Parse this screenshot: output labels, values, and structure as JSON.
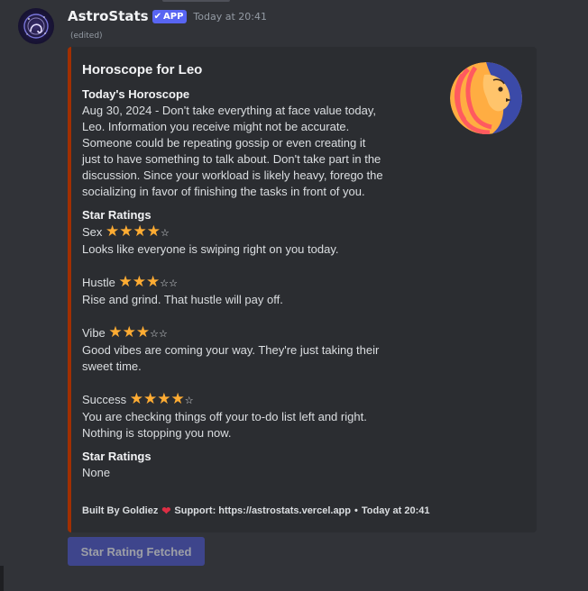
{
  "message": {
    "username": "AstroStats",
    "app_badge": "APP",
    "timestamp": "Today at 20:41",
    "edited": "(edited)"
  },
  "embed": {
    "title": "Horoscope for Leo",
    "accent_color": "#a12f00",
    "todays_horoscope": {
      "name": "Today's Horoscope",
      "value": "Aug 30, 2024 - Don't take everything at face value today, Leo. Information you receive might not be accurate. Someone could be repeating gossip or even creating it just to have something to talk about. Don't take part in the discussion. Since your workload is likely heavy, forego the socializing in favor of finishing the tasks in front of you."
    },
    "star_ratings": {
      "name": "Star Ratings",
      "items": [
        {
          "label": "Sex",
          "rating": 4,
          "max": 5,
          "description": "Looks like everyone is swiping right on you today."
        },
        {
          "label": "Hustle",
          "rating": 3,
          "max": 5,
          "description": "Rise and grind. That hustle will pay off."
        },
        {
          "label": "Vibe",
          "rating": 3,
          "max": 5,
          "description": "Good vibes are coming your way. They're just taking their sweet time."
        },
        {
          "label": "Success",
          "rating": 4,
          "max": 5,
          "description": "You are checking things off your to-do list left and right. Nothing is stopping you now."
        }
      ]
    },
    "star_ratings_2": {
      "name": "Star Ratings",
      "value": "None"
    },
    "footer": {
      "built_by": "Built By Goldiez",
      "support": "Support: https://astrostats.vercel.app",
      "separator": "•",
      "timestamp": "Today at 20:41"
    }
  },
  "button": {
    "label": "Star Rating Fetched"
  },
  "icons": {
    "badge_check": "checkmark-icon",
    "heart": "heart-icon",
    "star_full": "star-filled-icon",
    "star_empty": "star-outline-icon"
  }
}
